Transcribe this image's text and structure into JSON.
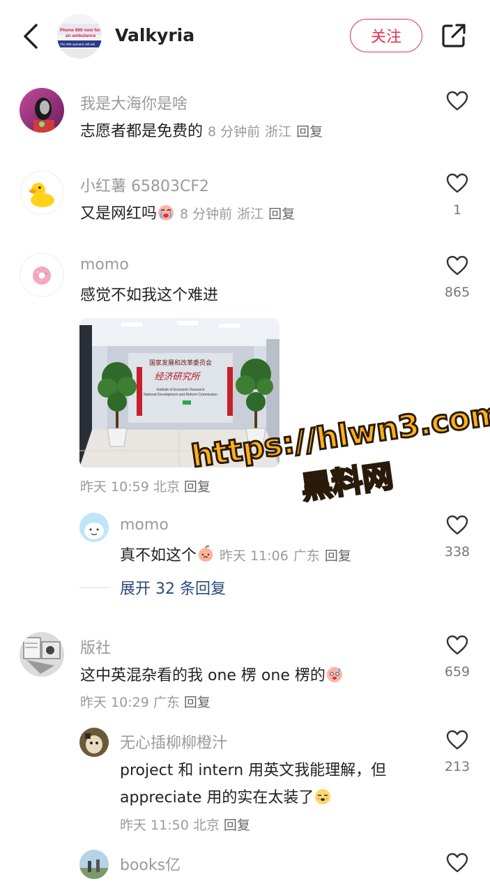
{
  "header": {
    "title": "Valkyria",
    "follow_label": "关注",
    "avatar_text": [
      "Phone 999 now for",
      "an ambulance",
      "The 999 operator will ask"
    ]
  },
  "comments": [
    {
      "user": "我是大海你是啥",
      "text": "志愿者都是免费的",
      "time": "8 分钟前",
      "location": "浙江",
      "reply_label": "回复",
      "likes": ""
    },
    {
      "user": "小红薯 65803CF2",
      "text": "又是网红吗",
      "time": "8 分钟前",
      "location": "浙江",
      "reply_label": "回复",
      "likes": "1"
    },
    {
      "user": "momo",
      "text": "感觉不如我这个难进",
      "photo_text": {
        "cn_title": "国家发展和改革委员会",
        "calligraphy": "经济研究所",
        "en_line1": "Institute of Economic Research",
        "en_line2": "National Development and Reform Commission"
      },
      "time": "昨天 10:59",
      "location": "北京",
      "reply_label": "回复",
      "likes": "865"
    },
    {
      "user": "momo",
      "text": "真不如这个",
      "time": "昨天 11:06",
      "location": "广东",
      "reply_label": "回复",
      "likes": "338"
    },
    {
      "user": "版社",
      "text": "这中英混杂看的我 one 楞 one 楞的",
      "time": "昨天 10:29",
      "location": "广东",
      "reply_label": "回复",
      "likes": "659"
    },
    {
      "user": "无心插柳柳橙汁",
      "text_line1": "project 和 intern 用英文我能理解，但",
      "text_line2": "appreciate 用的实在太装了",
      "time": "昨天 11:50",
      "location": "北京",
      "reply_label": "回复",
      "likes": "213"
    },
    {
      "user": "books亿",
      "likes": ""
    }
  ],
  "expand_label": "展开 32 条回复",
  "watermark": {
    "line1": "https://hlwn3.com",
    "line2": "黑料网"
  },
  "icons": {
    "back": "chevron-left-icon",
    "share": "share-icon",
    "like": "heart-outline-icon"
  },
  "colors": {
    "accent": "#e53150",
    "meta": "#9a9a9a",
    "expand": "#2a4a7a"
  }
}
